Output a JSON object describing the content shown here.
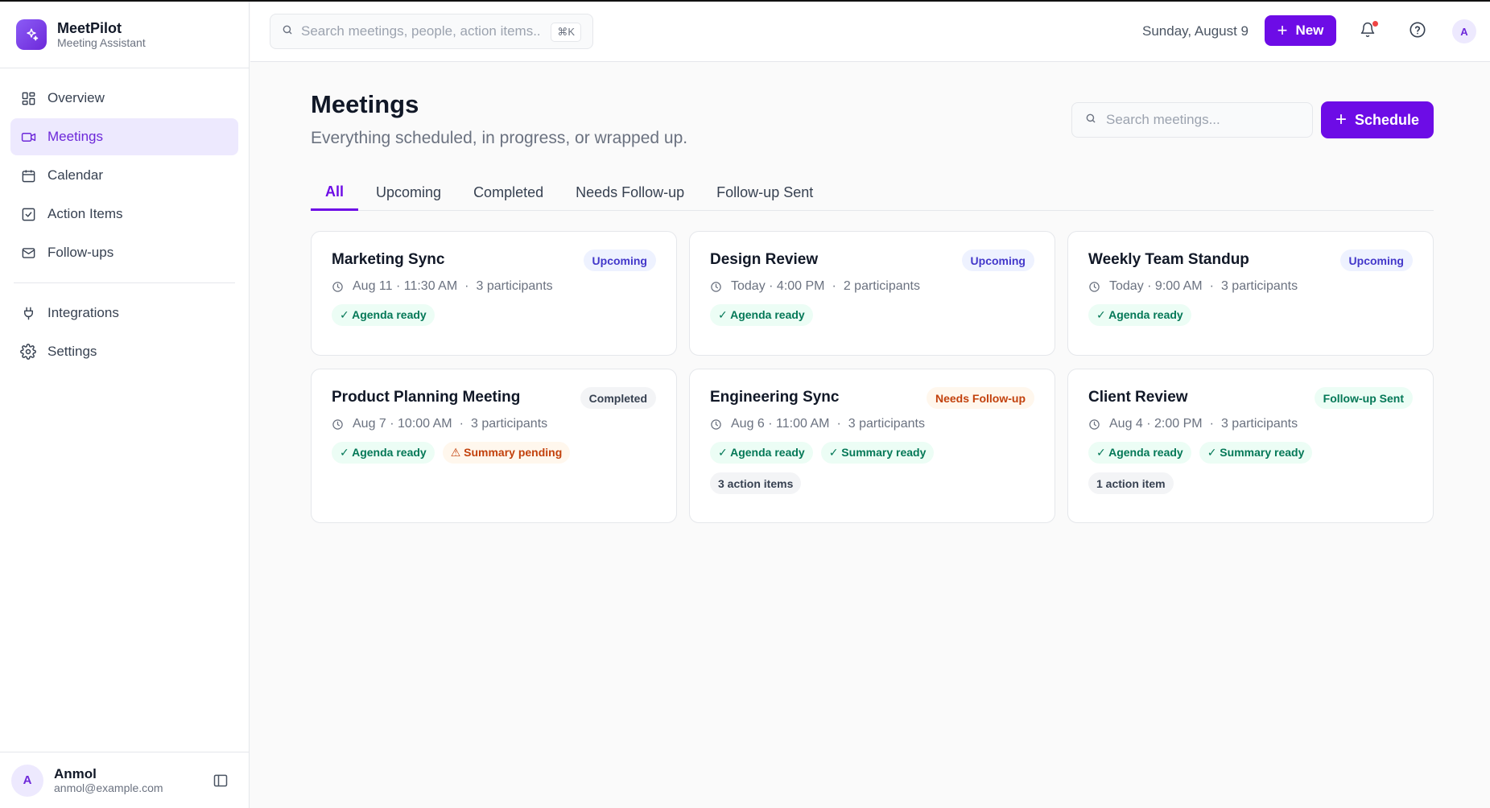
{
  "app": {
    "name": "MeetPilot",
    "tagline": "Meeting Assistant"
  },
  "sidebar": {
    "items": [
      {
        "label": "Overview",
        "icon": "grid-icon"
      },
      {
        "label": "Meetings",
        "icon": "video-icon",
        "active": true
      },
      {
        "label": "Calendar",
        "icon": "calendar-icon"
      },
      {
        "label": "Action Items",
        "icon": "check-square-icon"
      },
      {
        "label": "Follow-ups",
        "icon": "mail-icon"
      }
    ],
    "secondary": [
      {
        "label": "Integrations",
        "icon": "plug-icon"
      },
      {
        "label": "Settings",
        "icon": "gear-icon"
      }
    ],
    "user": {
      "initial": "A",
      "name": "Anmol",
      "email": "anmol@example.com"
    }
  },
  "topbar": {
    "search_placeholder": "Search meetings, people, action items...",
    "shortcut": "⌘K",
    "date": "Sunday, August 9",
    "new_label": "New",
    "avatar_initial": "A"
  },
  "page": {
    "title": "Meetings",
    "subtitle": "Everything scheduled, in progress, or wrapped up.",
    "search_placeholder": "Search meetings...",
    "schedule_label": "Schedule",
    "tabs": [
      {
        "label": "All",
        "active": true
      },
      {
        "label": "Upcoming"
      },
      {
        "label": "Completed"
      },
      {
        "label": "Needs Follow-up"
      },
      {
        "label": "Follow-up Sent"
      }
    ]
  },
  "meetings": [
    {
      "title": "Marketing Sync",
      "status": "Upcoming",
      "when": "Aug 11 · 11:30 AM",
      "sep": "·",
      "participants": "3 participants",
      "tags": [
        {
          "text": "✓ Agenda ready"
        }
      ]
    },
    {
      "title": "Design Review",
      "status": "Upcoming",
      "when": "Today · 4:00 PM",
      "sep": "·",
      "participants": "2 participants",
      "tags": [
        {
          "text": "✓ Agenda ready"
        }
      ]
    },
    {
      "title": "Weekly Team Standup",
      "status": "Upcoming",
      "when": "Today · 9:00 AM",
      "sep": "·",
      "participants": "3 participants",
      "tags": [
        {
          "text": "✓ Agenda ready"
        }
      ]
    },
    {
      "title": "Product Planning Meeting",
      "status": "Completed",
      "when": "Aug 7 · 10:00 AM",
      "sep": "·",
      "participants": "3 participants",
      "tags": [
        {
          "text": "✓ Agenda ready"
        },
        {
          "text": "⚠ Summary pending"
        }
      ]
    },
    {
      "title": "Engineering Sync",
      "status": "Needs Follow-up",
      "when": "Aug 6 · 11:00 AM",
      "sep": "·",
      "participants": "3 participants",
      "tags": [
        {
          "text": "✓ Agenda ready"
        },
        {
          "text": "✓ Summary ready"
        }
      ],
      "action_items": "3 action items"
    },
    {
      "title": "Client Review",
      "status": "Follow-up Sent",
      "when": "Aug 4 · 2:00 PM",
      "sep": "·",
      "participants": "3 participants",
      "tags": [
        {
          "text": "✓ Agenda ready"
        },
        {
          "text": "✓ Summary ready"
        }
      ],
      "action_items": "1 action item"
    }
  ],
  "colors": {
    "accent": "#6d0ce6",
    "accent_soft": "#ede9fe",
    "upcoming": "#4338ca",
    "needs_follow_up": "#c2410c",
    "success": "#047857"
  }
}
